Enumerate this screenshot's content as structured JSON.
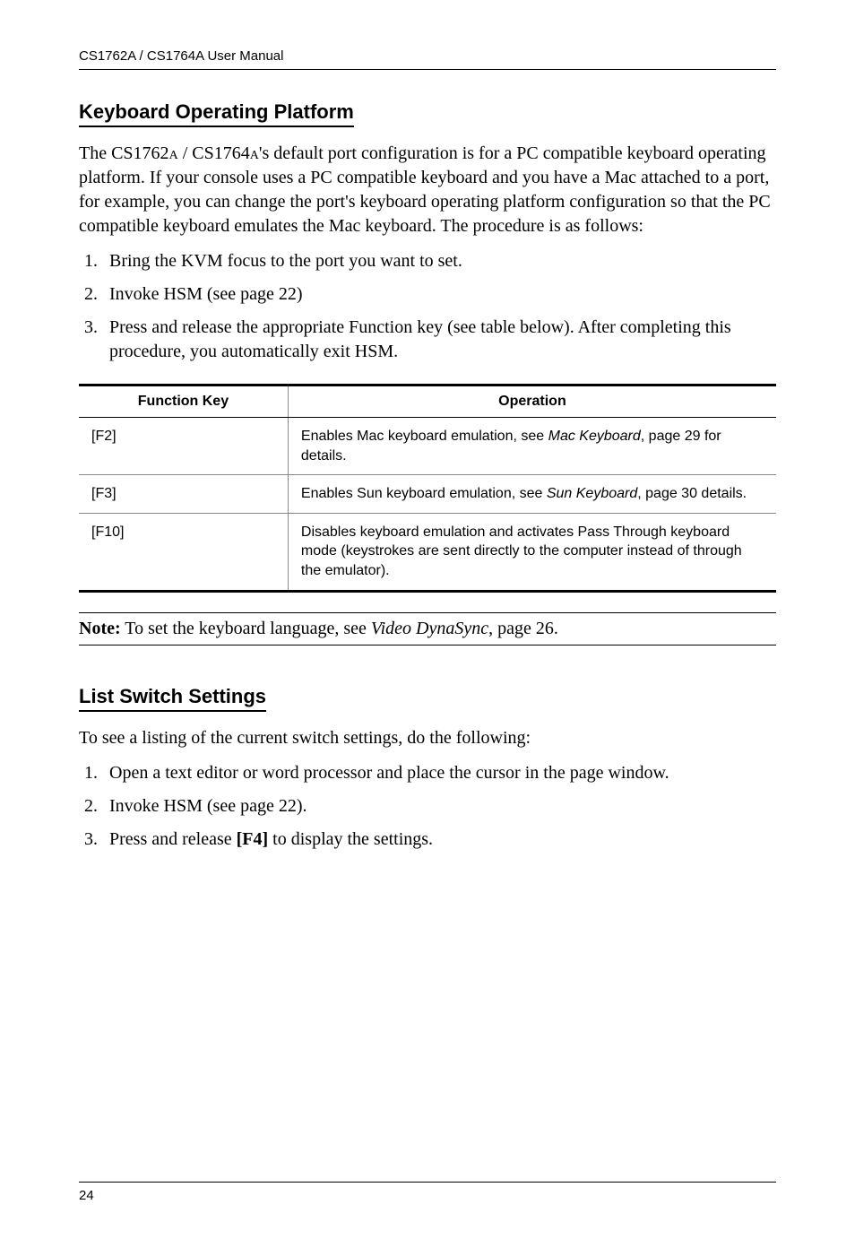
{
  "running_head": "CS1762A / CS1764A User Manual",
  "section1": {
    "title": "Keyboard Operating Platform",
    "intro": "The CS1762A / CS1764A's default port configuration is for a PC compatible keyboard operating platform. If your console uses a PC compatible keyboard and you have a Mac attached to a port, for example, you can change the port's keyboard operating platform configuration so that the PC compatible keyboard emulates the Mac keyboard. The procedure is as follows:",
    "steps": [
      "Bring the KVM focus to the port you want to set.",
      "Invoke HSM (see page 22)",
      "Press and release the appropriate Function key (see table below). After completing this procedure, you automatically exit HSM."
    ]
  },
  "table": {
    "head_key": "Function Key",
    "head_op": "Operation",
    "rows": [
      {
        "key": "[F2]",
        "op_pre": "Enables Mac keyboard emulation, see ",
        "op_ital": "Mac Keyboard",
        "op_post": ", page 29 for details."
      },
      {
        "key": "[F3]",
        "op_pre": "Enables Sun keyboard emulation, see ",
        "op_ital": "Sun Keyboard",
        "op_post": ", page 30 details."
      },
      {
        "key": "[F10]",
        "op_pre": "Disables keyboard emulation and activates Pass Through keyboard mode (keystrokes are sent directly to the computer instead of through the emulator).",
        "op_ital": "",
        "op_post": ""
      }
    ]
  },
  "note": {
    "label": "Note:",
    "text_pre": "  To set the keyboard language, see ",
    "text_ital": "Video DynaSync",
    "text_post": ", page 26."
  },
  "section2": {
    "title": "List Switch Settings",
    "intro": "To see a listing of the current switch settings, do the following:",
    "steps": [
      {
        "pre": "Open a text editor or word processor and place the cursor in the page window.",
        "bold": "",
        "post": ""
      },
      {
        "pre": "Invoke HSM (see page 22).",
        "bold": "",
        "post": ""
      },
      {
        "pre": "Press and release ",
        "bold": "[F4]",
        "post": " to display the settings."
      }
    ]
  },
  "page_number": "24"
}
